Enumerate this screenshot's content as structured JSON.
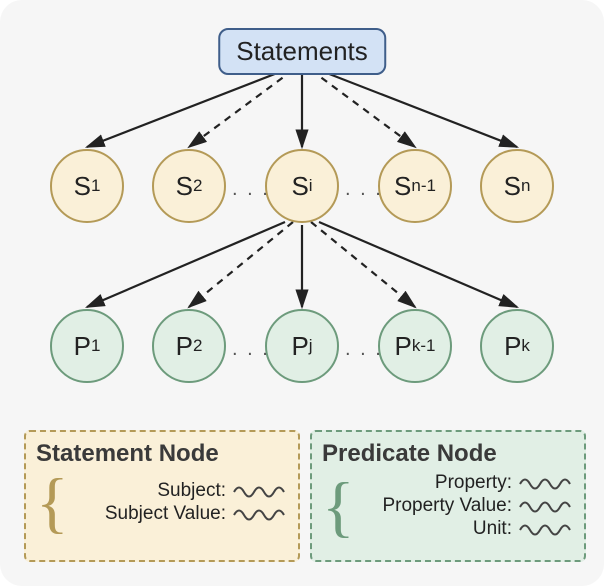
{
  "root": {
    "label": "Statements"
  },
  "s_nodes": [
    {
      "label": "S",
      "sub": "1"
    },
    {
      "label": "S",
      "sub": "2"
    },
    {
      "label": "S",
      "sub": "i"
    },
    {
      "label": "S",
      "sub": "n-1"
    },
    {
      "label": "S",
      "sub": "n"
    }
  ],
  "p_nodes": [
    {
      "label": "P",
      "sub": "1"
    },
    {
      "label": "P",
      "sub": "2"
    },
    {
      "label": "P",
      "sub": "j"
    },
    {
      "label": "P",
      "sub": "k-1"
    },
    {
      "label": "P",
      "sub": "k"
    }
  ],
  "ellipsis": ". . .",
  "legend": {
    "statement": {
      "title": "Statement Node",
      "fields": [
        "Subject:",
        "Subject Value:"
      ]
    },
    "predicate": {
      "title": "Predicate Node",
      "fields": [
        "Property:",
        "Property Value:",
        "Unit:"
      ]
    }
  },
  "colors": {
    "s_fill": "#faf0d8",
    "s_border": "#b49a57",
    "p_fill": "#e1efe5",
    "p_border": "#6d9b7c",
    "root_fill": "#d3e2f5",
    "root_border": "#3f5e8a",
    "arrow": "#222"
  },
  "chart_data": {
    "type": "diagram-tree",
    "root": "Statements",
    "levels": [
      {
        "name": "statement-nodes",
        "labels": [
          "S_1",
          "S_2",
          "S_i",
          "S_{n-1}",
          "S_n"
        ],
        "ellipsis_between": [
          [
            1,
            2
          ],
          [
            2,
            3
          ]
        ]
      },
      {
        "name": "predicate-nodes",
        "labels": [
          "P_1",
          "P_2",
          "P_j",
          "P_{k-1}",
          "P_k"
        ],
        "ellipsis_between": [
          [
            1,
            2
          ],
          [
            2,
            3
          ]
        ]
      }
    ],
    "edges": [
      {
        "from": "Statements",
        "to": "S_1",
        "style": "solid"
      },
      {
        "from": "Statements",
        "to": "S_2",
        "style": "dashed"
      },
      {
        "from": "Statements",
        "to": "S_i",
        "style": "solid"
      },
      {
        "from": "Statements",
        "to": "S_{n-1}",
        "style": "dashed"
      },
      {
        "from": "Statements",
        "to": "S_n",
        "style": "solid"
      },
      {
        "from": "S_i",
        "to": "P_1",
        "style": "solid"
      },
      {
        "from": "S_i",
        "to": "P_2",
        "style": "dashed"
      },
      {
        "from": "S_i",
        "to": "P_j",
        "style": "solid"
      },
      {
        "from": "S_i",
        "to": "P_{k-1}",
        "style": "dashed"
      },
      {
        "from": "S_i",
        "to": "P_k",
        "style": "solid"
      }
    ],
    "legend": {
      "Statement Node": {
        "fields": [
          "Subject",
          "Subject Value"
        ]
      },
      "Predicate Node": {
        "fields": [
          "Property",
          "Property Value",
          "Unit"
        ]
      }
    }
  }
}
